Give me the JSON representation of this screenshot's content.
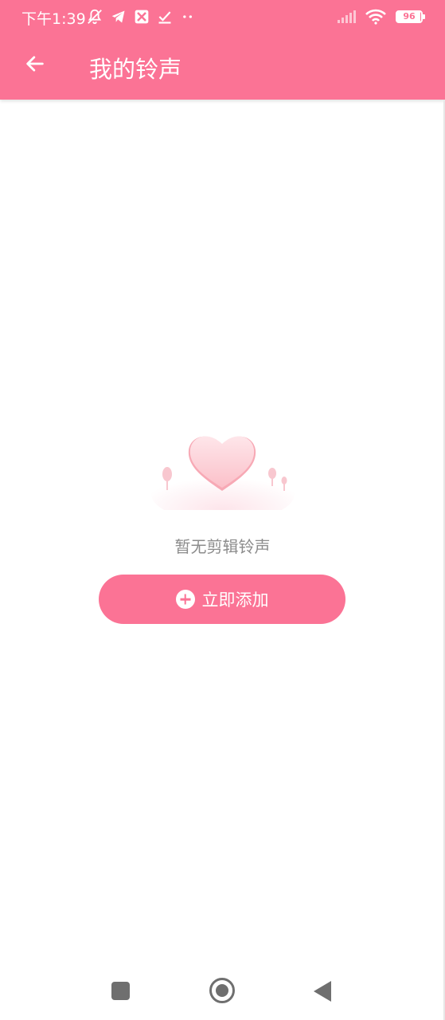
{
  "status_bar": {
    "time": "下午1:39",
    "battery": "96",
    "icons_left": [
      "muted-bell-icon",
      "telegram-icon",
      "app-icon",
      "check-icon",
      "more-dots-icon"
    ],
    "icons_right": [
      "signal-icon",
      "wifi-icon",
      "battery-icon"
    ]
  },
  "app_bar": {
    "title": "我的铃声",
    "back_icon": "arrow-left-icon"
  },
  "empty_state": {
    "message": "暂无剪辑铃声",
    "button_label": "立即添加",
    "button_icon": "plus-circle-icon"
  },
  "colors": {
    "accent": "#fb7395",
    "text_muted": "#8c8c8c",
    "nav_icon": "#6f6f6f"
  },
  "nav_bar": {
    "items": [
      "recents-button",
      "home-button",
      "back-button"
    ]
  }
}
